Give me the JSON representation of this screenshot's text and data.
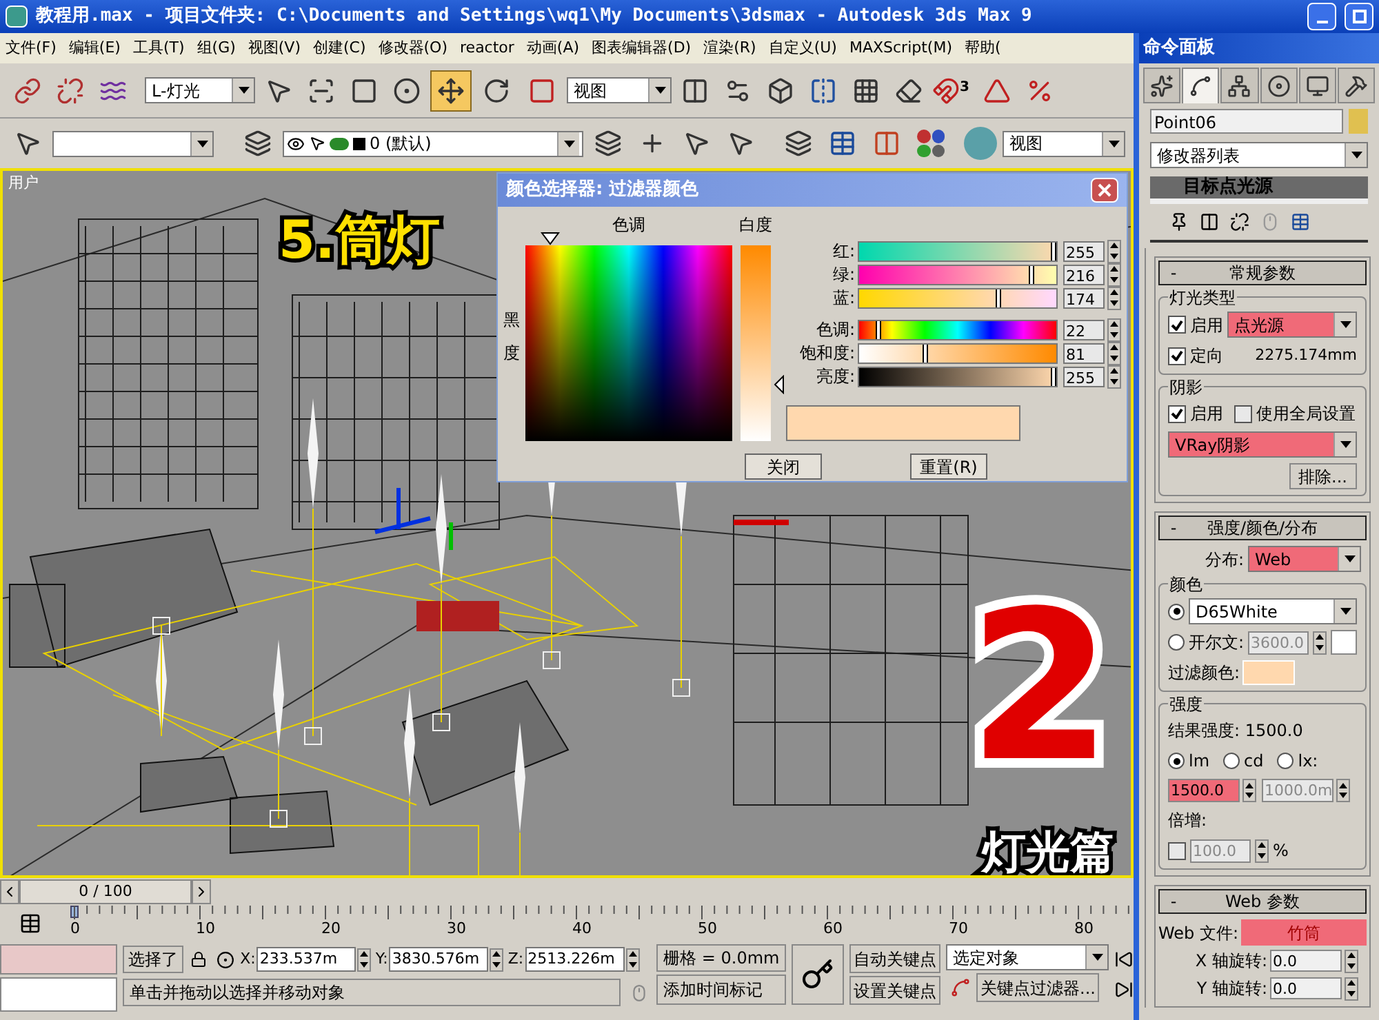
{
  "window": {
    "title": "教程用.max    - 项目文件夹: C:\\Documents and Settings\\wq1\\My Documents\\3dsmax    - Autodesk 3ds Max 9"
  },
  "menu": [
    "文件(F)",
    "编辑(E)",
    "工具(T)",
    "组(G)",
    "视图(V)",
    "创建(C)",
    "修改器(O)",
    "reactor",
    "动画(A)",
    "图表编辑器(D)",
    "渲染(R)",
    "自定义(U)",
    "MAXScript(M)",
    "帮助("
  ],
  "toolbar": {
    "selection_filter": "L-灯光",
    "reference_coord": "视图",
    "transform_tools": [
      {
        "kind": "move",
        "selected": true
      },
      {
        "kind": "rotate",
        "selected": false
      },
      {
        "kind": "scale",
        "selected": false
      }
    ],
    "snap_label": "3",
    "layer": "0 (默认)",
    "render_type": "视图"
  },
  "viewport": {
    "label": "用户",
    "annotations": [
      {
        "kind": "title",
        "text": "5.筒灯"
      },
      {
        "kind": "number",
        "text": "2"
      },
      {
        "kind": "subtitle",
        "text": "灯光篇"
      }
    ]
  },
  "color_dialog": {
    "title": "颜色选择器: 过滤器颜色",
    "hue_label": "色调",
    "whiteness_label": "白度",
    "blackness_label": "黑度",
    "channels": [
      {
        "kind": "red",
        "label": "红:",
        "value": "255",
        "level": 1
      },
      {
        "kind": "green",
        "label": "绿:",
        "value": "216",
        "level": 0.847
      },
      {
        "kind": "blue",
        "label": "蓝:",
        "value": "174",
        "level": 0.682
      },
      {
        "kind": "hue",
        "label": "色调:",
        "value": "22",
        "level": 0.086
      },
      {
        "kind": "saturation",
        "label": "饱和度:",
        "value": "81",
        "level": 0.318
      },
      {
        "kind": "value",
        "label": "亮度:",
        "value": "255",
        "level": 1
      }
    ],
    "sample": {
      "color": "#ffd8ae"
    },
    "buttons": [
      "关闭",
      "重置(R)"
    ]
  },
  "command_panel": {
    "title": "命令面板",
    "tabs": [
      {
        "kind": "create",
        "selected": false
      },
      {
        "kind": "modify",
        "selected": true
      },
      {
        "kind": "hierarchy",
        "selected": false
      },
      {
        "kind": "motion",
        "selected": false
      },
      {
        "kind": "display",
        "selected": false
      },
      {
        "kind": "utilities",
        "selected": false
      }
    ],
    "object_name": "Point06",
    "object_swatch": {
      "color": "#e0c050"
    },
    "modifier_list": "修改器列表",
    "stack_item": "目标点光源",
    "general": {
      "collapse_sign": "-",
      "title": "常规参数",
      "light_type_group": "灯光类型",
      "light_on_label": "启用",
      "light_on": true,
      "light_type": "点光源",
      "light_type_highlighted": true,
      "targeted_label": "定向",
      "targeted": true,
      "target_distance": "2275.174mm",
      "shadows_group": "阴影",
      "shadow_on_label": "启用",
      "shadow_on": true,
      "global_label": "使用全局设置",
      "use_global": false,
      "shadow_type": "VRay阴影",
      "shadow_type_highlighted": true,
      "exclude": "排除..."
    },
    "intensity": {
      "collapse_sign": "-",
      "title": "强度/颜色/分布",
      "distribution_label": "分布:",
      "distribution": "Web",
      "distribution_highlighted": true,
      "color_group": "颜色",
      "color_options": [
        {
          "kind": "preset",
          "label": "D65White",
          "selected": true
        },
        {
          "kind": "kelvin",
          "label": "开尔文:",
          "value": "3600.0",
          "selected": false
        }
      ],
      "kelvin_swatch": {
        "color": "#ffffff"
      },
      "filter_label": "过滤颜色:",
      "filter_swatch": {
        "color": "#ffd8ae"
      },
      "intensity_group": "强度",
      "result": "结果强度: 1500.0",
      "units": [
        {
          "label": "lm",
          "selected": true
        },
        {
          "label": "cd",
          "selected": false
        },
        {
          "label": "lx:",
          "selected": false
        }
      ],
      "intensity_value": "1500.0",
      "intensity_highlighted": true,
      "distance_value": "1000.0m",
      "multiplier_label": "倍增:",
      "multiplier_on": false,
      "multiplier_value": "100.0",
      "percent": "%"
    },
    "web": {
      "collapse_sign": "-",
      "title": "Web 参数",
      "file_label": "Web 文件:",
      "file": "竹筒",
      "file_highlighted": true,
      "rotations": [
        {
          "label": "X 轴旋转:",
          "value": "0.0"
        },
        {
          "label": "Y 轴旋转:",
          "value": "0.0"
        }
      ]
    }
  },
  "timeline": {
    "frame": "0 / 100",
    "ruler_labels": [
      "0",
      "10",
      "20",
      "30",
      "40",
      "50",
      "60",
      "70",
      "80"
    ]
  },
  "status": {
    "selection": "选择了",
    "x_label": "X:",
    "x": "233.537m",
    "y_label": "Y:",
    "y": "3830.576m",
    "z_label": "Z:",
    "z": "2513.226m",
    "grid": "栅格 = 0.0mm",
    "prompt": "单击并拖动以选择并移动对象",
    "time_tag": "添加时间标记",
    "auto_key": "自动关键点",
    "set_key": "设置关键点",
    "key_mode": "选定对象",
    "key_filters": "关键点过滤器..."
  }
}
